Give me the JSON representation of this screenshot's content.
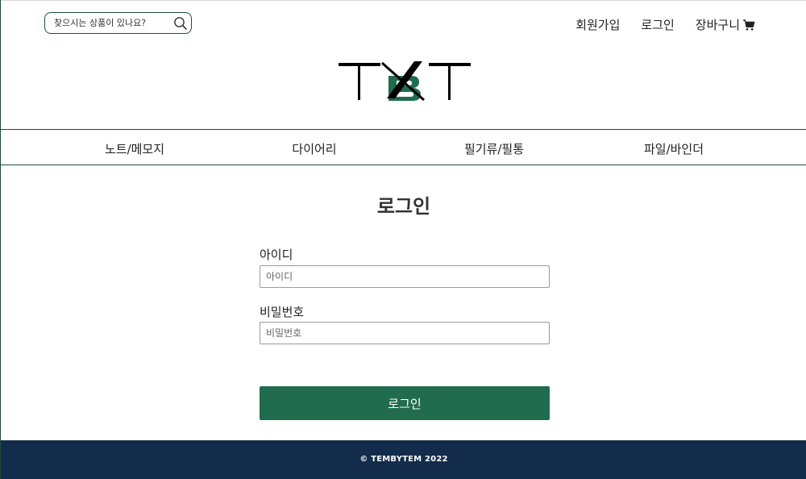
{
  "header": {
    "search": {
      "placeholder": "찾으시는 상품이 있나요?",
      "value": "",
      "icon": "search-icon"
    },
    "links": [
      {
        "label": "회원가입"
      },
      {
        "label": "로그인"
      },
      {
        "label": "장바구니",
        "icon": "cart-icon"
      }
    ],
    "logo": {
      "text": "TBT",
      "colors": {
        "primary": "#000000",
        "accent": "#216b4e"
      }
    }
  },
  "categories": [
    {
      "label": "노트/메모지"
    },
    {
      "label": "다이어리"
    },
    {
      "label": "필기류/필통"
    },
    {
      "label": "파일/바인더"
    }
  ],
  "login": {
    "title": "로그인",
    "id_field": {
      "label": "아이디",
      "placeholder": "아이디",
      "value": ""
    },
    "password_field": {
      "label": "비밀번호",
      "placeholder": "비밀번호",
      "value": ""
    },
    "submit_label": "로그인"
  },
  "footer": {
    "copyright": "© TEMBYTEM 2022"
  },
  "colors": {
    "brand_green": "#216b4e",
    "border_green": "#1f4d3a",
    "footer_navy": "#132c4b"
  }
}
